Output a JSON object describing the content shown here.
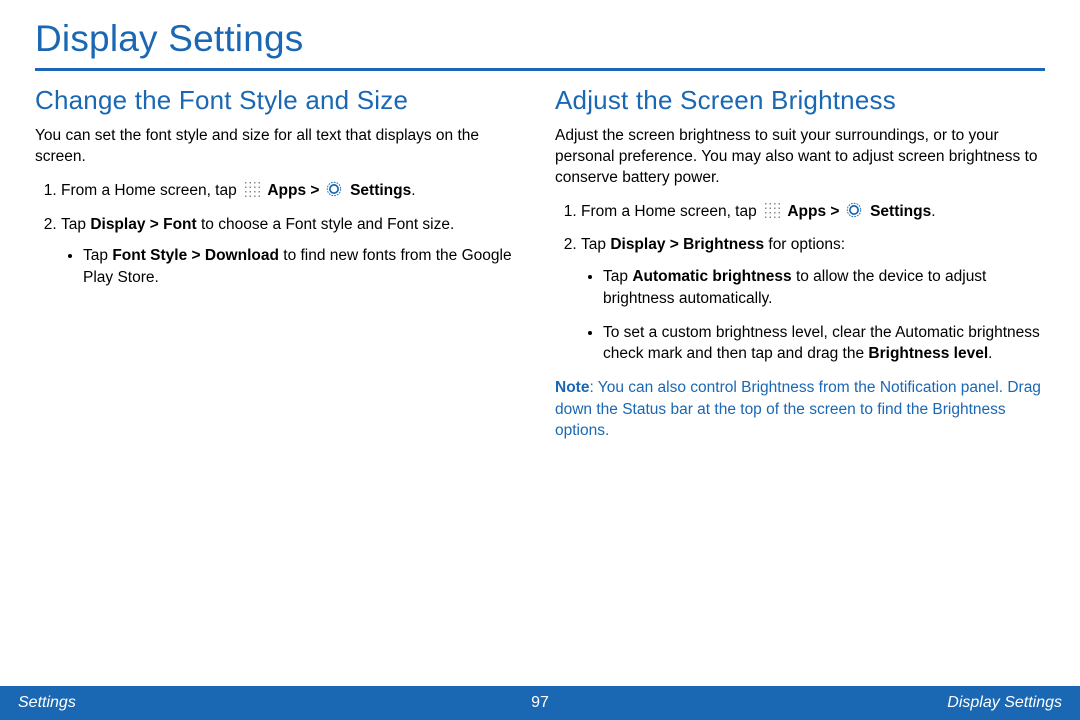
{
  "title": "Display Settings",
  "left": {
    "heading": "Change the Font Style and Size",
    "intro": "You can set the font style and size for all text that displays on the screen.",
    "step1_a": "From a Home screen, tap ",
    "step1_b": "Apps > ",
    "step1_c": "Settings",
    "step1_d": ".",
    "step2_a": "Tap ",
    "step2_b": "Display > Font",
    "step2_c": " to choose a Font style and Font size.",
    "bullet1_a": "Tap ",
    "bullet1_b": "Font Style > Download",
    "bullet1_c": " to find new fonts from the Google Play Store."
  },
  "right": {
    "heading": "Adjust the Screen Brightness",
    "intro": "Adjust the screen brightness to suit your surroundings, or to your personal preference. You may also want to adjust screen brightness to conserve battery power.",
    "step1_a": "From a Home screen, tap ",
    "step1_b": "Apps > ",
    "step1_c": "Settings",
    "step1_d": ".",
    "step2_a": "Tap ",
    "step2_b": "Display > Brightness",
    "step2_c": " for options:",
    "bullet1_a": "Tap ",
    "bullet1_b": "Automatic brightness",
    "bullet1_c": " to allow the device to adjust brightness automatically.",
    "bullet2_a": "To set a custom brightness level, clear the Automatic brightness check mark and then tap and drag the ",
    "bullet2_b": "Brightness level",
    "bullet2_c": ".",
    "note_label": "Note",
    "note_body": ": You can also control Brightness from the Notification panel. Drag down the Status bar at the top of the screen to find the Brightness options."
  },
  "footer": {
    "left": "Settings",
    "center": "97",
    "right": "Display Settings"
  }
}
